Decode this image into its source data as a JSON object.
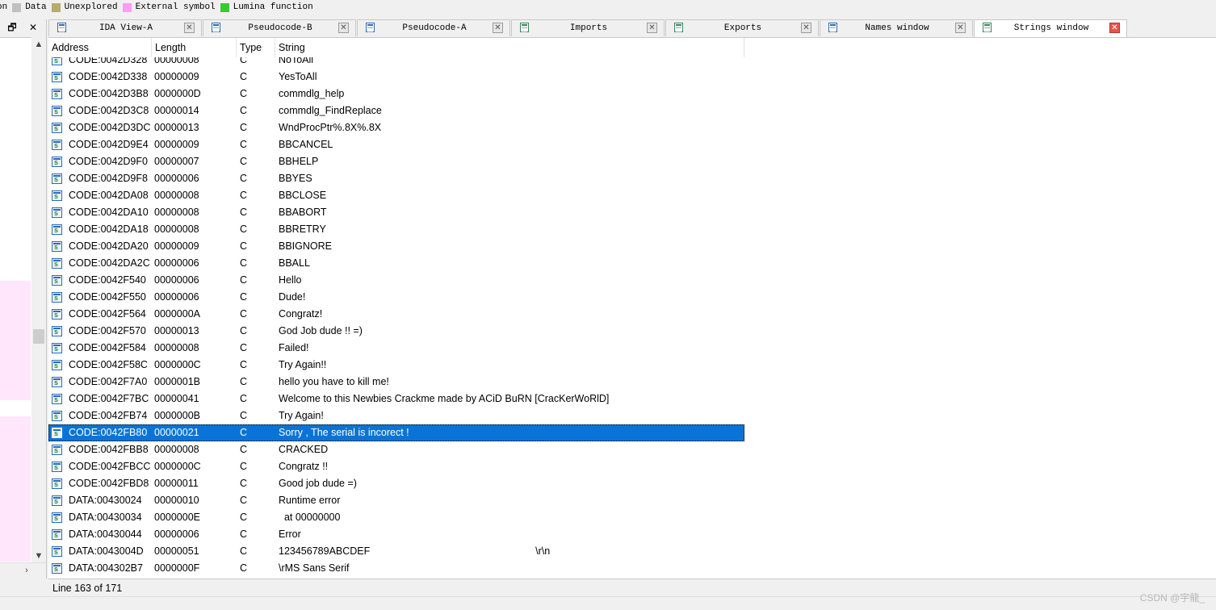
{
  "legend": [
    {
      "label": "on",
      "color": ""
    },
    {
      "label": "Data",
      "color": "#c0c0c0"
    },
    {
      "label": "Unexplored",
      "color": "#b5ad6b"
    },
    {
      "label": "External symbol",
      "color": "#ff9cf4"
    },
    {
      "label": "Lumina function",
      "color": "#33cc33"
    }
  ],
  "left_panel": {
    "restore_glyph": "🗗",
    "close_glyph": "✕"
  },
  "tabs": [
    {
      "label": "IDA View-A",
      "icon": "disassembly-icon",
      "active": false
    },
    {
      "label": "Pseudocode-B",
      "icon": "pseudocode-icon",
      "active": false
    },
    {
      "label": "Pseudocode-A",
      "icon": "pseudocode-icon",
      "active": false
    },
    {
      "label": "Imports",
      "icon": "imports-icon",
      "active": false
    },
    {
      "label": "Exports",
      "icon": "exports-icon",
      "active": false
    },
    {
      "label": "Names window",
      "icon": "names-icon",
      "active": false
    },
    {
      "label": "Strings window",
      "icon": "strings-icon",
      "active": true
    }
  ],
  "tab_close_glyph": "✕",
  "columns": [
    "Address",
    "Length",
    "Type",
    "String"
  ],
  "rows": [
    {
      "address": "CODE:0042D328",
      "length": "00000008",
      "type": "C",
      "string": "NoToAll"
    },
    {
      "address": "CODE:0042D338",
      "length": "00000009",
      "type": "C",
      "string": "YesToAll"
    },
    {
      "address": "CODE:0042D3B8",
      "length": "0000000D",
      "type": "C",
      "string": "commdlg_help"
    },
    {
      "address": "CODE:0042D3C8",
      "length": "00000014",
      "type": "C",
      "string": "commdlg_FindReplace"
    },
    {
      "address": "CODE:0042D3DC",
      "length": "00000013",
      "type": "C",
      "string": "WndProcPtr%.8X%.8X"
    },
    {
      "address": "CODE:0042D9E4",
      "length": "00000009",
      "type": "C",
      "string": "BBCANCEL"
    },
    {
      "address": "CODE:0042D9F0",
      "length": "00000007",
      "type": "C",
      "string": "BBHELP"
    },
    {
      "address": "CODE:0042D9F8",
      "length": "00000006",
      "type": "C",
      "string": "BBYES"
    },
    {
      "address": "CODE:0042DA08",
      "length": "00000008",
      "type": "C",
      "string": "BBCLOSE"
    },
    {
      "address": "CODE:0042DA10",
      "length": "00000008",
      "type": "C",
      "string": "BBABORT"
    },
    {
      "address": "CODE:0042DA18",
      "length": "00000008",
      "type": "C",
      "string": "BBRETRY"
    },
    {
      "address": "CODE:0042DA20",
      "length": "00000009",
      "type": "C",
      "string": "BBIGNORE"
    },
    {
      "address": "CODE:0042DA2C",
      "length": "00000006",
      "type": "C",
      "string": "BBALL"
    },
    {
      "address": "CODE:0042F540",
      "length": "00000006",
      "type": "C",
      "string": "Hello"
    },
    {
      "address": "CODE:0042F550",
      "length": "00000006",
      "type": "C",
      "string": "Dude!"
    },
    {
      "address": "CODE:0042F564",
      "length": "0000000A",
      "type": "C",
      "string": "Congratz!"
    },
    {
      "address": "CODE:0042F570",
      "length": "00000013",
      "type": "C",
      "string": "God Job dude !! =)"
    },
    {
      "address": "CODE:0042F584",
      "length": "00000008",
      "type": "C",
      "string": "Failed!"
    },
    {
      "address": "CODE:0042F58C",
      "length": "0000000C",
      "type": "C",
      "string": "Try Again!!"
    },
    {
      "address": "CODE:0042F7A0",
      "length": "0000001B",
      "type": "C",
      "string": "hello you have to kill me!"
    },
    {
      "address": "CODE:0042F7BC",
      "length": "00000041",
      "type": "C",
      "string": "Welcome to this Newbies Crackme made by ACiD BuRN [CracKerWoRlD]"
    },
    {
      "address": "CODE:0042FB74",
      "length": "0000000B",
      "type": "C",
      "string": "Try Again!"
    },
    {
      "address": "CODE:0042FB80",
      "length": "00000021",
      "type": "C",
      "string": "Sorry , The serial is incorect !",
      "selected": true
    },
    {
      "address": "CODE:0042FBB8",
      "length": "00000008",
      "type": "C",
      "string": "CRACKED"
    },
    {
      "address": "CODE:0042FBCC",
      "length": "0000000C",
      "type": "C",
      "string": "Congratz !!"
    },
    {
      "address": "CODE:0042FBD8",
      "length": "00000011",
      "type": "C",
      "string": "Good job dude =)"
    },
    {
      "address": "DATA:00430024",
      "length": "00000010",
      "type": "C",
      "string": "Runtime error"
    },
    {
      "address": "DATA:00430034",
      "length": "0000000E",
      "type": "C",
      "string": "  at 00000000"
    },
    {
      "address": "DATA:00430044",
      "length": "00000006",
      "type": "C",
      "string": "Error"
    },
    {
      "address": "DATA:0043004D",
      "length": "00000051",
      "type": "C",
      "string": "123456789ABCDEF                                                           \\r\\n"
    },
    {
      "address": "DATA:004302B7",
      "length": "0000000F",
      "type": "C",
      "string": "\\rMS Sans Serif"
    }
  ],
  "status": {
    "line": "Line 163 of 171"
  },
  "watermark": "CSDN @宇龍_"
}
